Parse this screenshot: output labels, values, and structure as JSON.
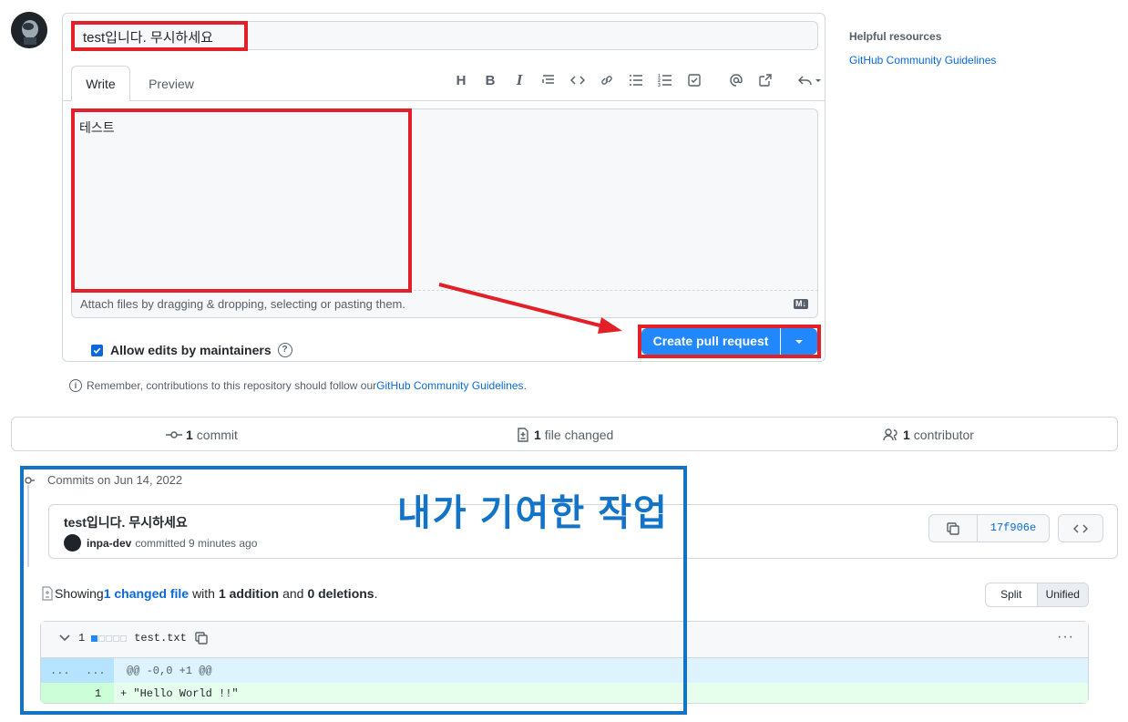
{
  "composer": {
    "title_value": "test입니다. 무시하세요",
    "tabs": [
      {
        "label": "Write"
      },
      {
        "label": "Preview"
      }
    ],
    "toolbar_icons": [
      "heading-icon",
      "bold-icon",
      "italic-icon",
      "quote-icon",
      "code-icon",
      "link-icon",
      "unordered-list-icon",
      "ordered-list-icon",
      "task-list-icon",
      "mention-icon",
      "reference-icon",
      "reply-icon"
    ],
    "body_value": "테스트",
    "attach_hint": "Attach files by dragging & dropping, selecting or pasting them.",
    "markdown_badge": "M↓",
    "allow_edits_label": "Allow edits by maintainers",
    "allow_edits_checked": true,
    "create_button_label": "Create pull request"
  },
  "remember": {
    "text": "Remember, contributions to this repository should follow our ",
    "link": "GitHub Community Guidelines",
    "suffix": "."
  },
  "sidebar": {
    "title": "Helpful resources",
    "link": "GitHub Community Guidelines"
  },
  "summary": {
    "commits_count": "1",
    "commits_label": "commit",
    "files_count": "1",
    "files_label": "file changed",
    "contributors_count": "1",
    "contributors_label": "contributor"
  },
  "commits": {
    "heading": "Commits on Jun 14, 2022",
    "message": "test입니다. 무시하세요",
    "author": "inpa-dev",
    "meta": "committed 9 minutes ago",
    "sha": "17f906e"
  },
  "diff": {
    "showing_prefix": "Showing ",
    "changed_link": "1 changed file",
    "with": " with ",
    "additions": "1 addition",
    "and": " and ",
    "deletions": "0 deletions",
    "period": ".",
    "split_label": "Split",
    "unified_label": "Unified",
    "file_count": "1",
    "diffstat_added_blocks": 1,
    "diffstat_total_blocks": 5,
    "filename": "test.txt",
    "hunk_left": "...",
    "hunk_right": "...",
    "hunk_header": "@@ -0,0 +1 @@",
    "line_number": "1",
    "line_code": "+ \"Hello World !!\""
  },
  "annotation": {
    "label": "내가 기여한 작업",
    "red": "#e32027",
    "blue": "#1273c7"
  },
  "colors": {
    "accent": "#0969da",
    "button": "#2188ff",
    "border": "#d0d7de"
  }
}
